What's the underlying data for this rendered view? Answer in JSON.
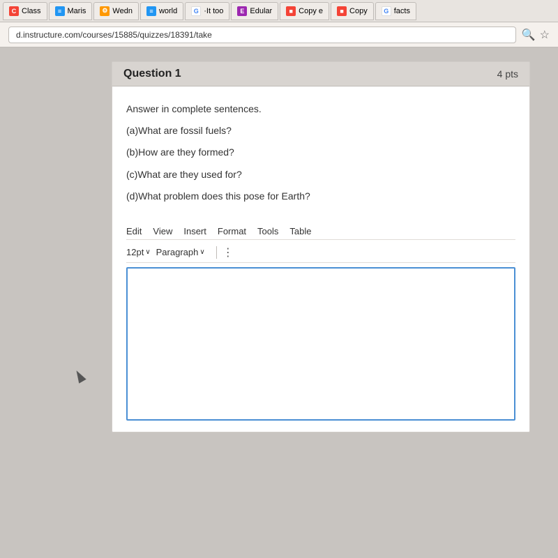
{
  "browser": {
    "tabs": [
      {
        "id": "class",
        "icon_type": "red",
        "icon_text": "C",
        "label": "Class"
      },
      {
        "id": "maris",
        "icon_type": "blue",
        "icon_text": "≡",
        "label": "Maris"
      },
      {
        "id": "wedn",
        "icon_type": "orange",
        "icon_text": "⚙",
        "label": "Wedn"
      },
      {
        "id": "world",
        "icon_type": "blue",
        "icon_text": "≡",
        "label": "world"
      },
      {
        "id": "iltoo",
        "icon_type": "google",
        "icon_text": "G",
        "label": "·It too"
      },
      {
        "id": "edular",
        "icon_type": "purple",
        "icon_text": "E+",
        "label": "Edular"
      },
      {
        "id": "copye",
        "icon_type": "red",
        "icon_text": "■",
        "label": "Copy e"
      },
      {
        "id": "copy",
        "icon_type": "red",
        "icon_text": "■",
        "label": "Copy"
      },
      {
        "id": "facts",
        "icon_type": "google",
        "icon_text": "G",
        "label": "facts"
      }
    ],
    "url": "d.instructure.com/courses/15885/quizzes/18391/take"
  },
  "question": {
    "title": "Question 1",
    "points": "4 pts",
    "instructions": "Answer in complete sentences.",
    "sub_questions": [
      "(a)What are fossil fuels?",
      "(b)How are they formed?",
      "(c)What are they used for?",
      "(d)What problem does this pose for Earth?"
    ],
    "editor": {
      "menu_items": [
        "Edit",
        "View",
        "Insert",
        "Format",
        "Tools",
        "Table"
      ],
      "font_size": "12pt",
      "font_size_chevron": "∨",
      "paragraph": "Paragraph",
      "paragraph_chevron": "∨",
      "more_options": "⋮"
    }
  }
}
